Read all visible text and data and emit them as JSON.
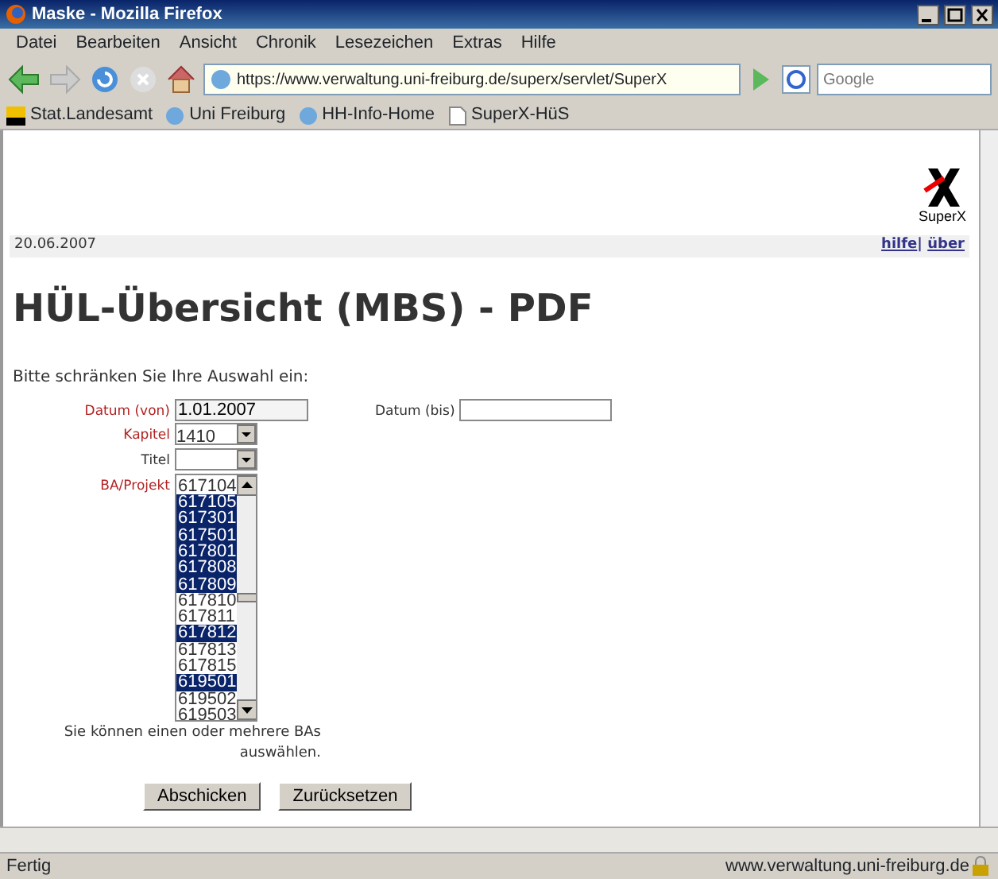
{
  "window": {
    "title": "Maske - Mozilla Firefox"
  },
  "menu": [
    "Datei",
    "Bearbeiten",
    "Ansicht",
    "Chronik",
    "Lesezeichen",
    "Extras",
    "Hilfe"
  ],
  "address_bar": {
    "value": "https://www.verwaltung.uni-freiburg.de/superx/servlet/SuperX"
  },
  "search": {
    "placeholder": "Google"
  },
  "bookmarks": [
    {
      "label": "Stat.Landesamt",
      "kind": "site"
    },
    {
      "label": "Uni Freiburg",
      "kind": "globe"
    },
    {
      "label": "HH-Info-Home",
      "kind": "globe"
    },
    {
      "label": "SuperX-HüS",
      "kind": "page"
    }
  ],
  "page": {
    "logo_text": "SuperX",
    "date": "20.06.2007",
    "links": [
      "hilfe",
      "über"
    ],
    "link_separator": "|",
    "heading": "HÜL-Übersicht (MBS) - PDF",
    "intro": "Bitte schränken Sie Ihre Auswahl ein:",
    "fields": {
      "datum_von": {
        "label": "Datum (von)",
        "value": "1.01.2007",
        "required": true
      },
      "datum_bis": {
        "label": "Datum (bis)",
        "required": false
      },
      "kapitel": {
        "label": "Kapitel",
        "value": "1410",
        "required": true
      },
      "titel": {
        "label": "Titel",
        "required": false
      },
      "ba_projekt": {
        "label": "BA/Projekt",
        "required": true,
        "options": [
          {
            "label": "617104",
            "selected": false
          },
          {
            "label": "617105",
            "selected": true
          },
          {
            "label": "617301",
            "selected": true
          },
          {
            "label": "617501",
            "selected": true
          },
          {
            "label": "617801",
            "selected": true
          },
          {
            "label": "617808",
            "selected": true
          },
          {
            "label": "617809",
            "selected": true
          },
          {
            "label": "617810",
            "selected": false
          },
          {
            "label": "617811",
            "selected": false
          },
          {
            "label": "617812",
            "selected": true
          },
          {
            "label": "617813",
            "selected": false
          },
          {
            "label": "617815",
            "selected": false
          },
          {
            "label": "619501",
            "selected": true
          },
          {
            "label": "619502",
            "selected": false
          },
          {
            "label": "619503",
            "selected": false
          }
        ]
      }
    },
    "hint": "Sie können einen oder mehrere BAs auswählen.",
    "buttons": [
      "Abschicken",
      "Zurücksetzen"
    ]
  },
  "status_bar": {
    "text": "Fertig",
    "url": "www.verwaltung.uni-freiburg.de"
  }
}
